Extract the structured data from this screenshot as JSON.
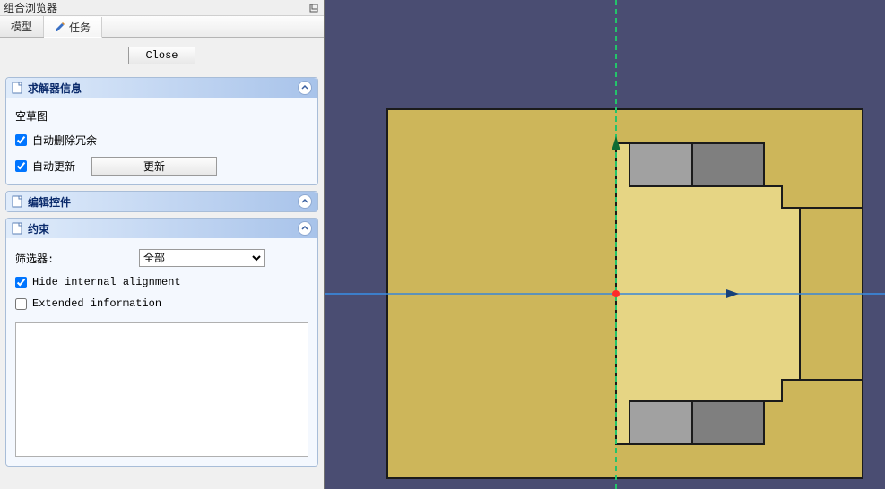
{
  "panel": {
    "title": "组合浏览器",
    "tabs": {
      "model": "模型",
      "tasks": "任务"
    },
    "close_label": "Close"
  },
  "solver_section": {
    "title": "求解器信息",
    "empty_sketch": "空草图",
    "auto_remove_redundant": "自动删除冗余",
    "auto_update": "自动更新",
    "update_btn": "更新"
  },
  "edit_section": {
    "title": "编辑控件"
  },
  "constraints_section": {
    "title": "约束",
    "filter_label": "筛选器:",
    "filter_value": "全部",
    "hide_internal": "Hide internal alignment",
    "extended_info": "Extended information"
  },
  "viewport": {
    "bg": "#4a4d72",
    "body_fill": "#cdb65a",
    "body_fill_light": "#e6d584",
    "step_fill": "#a1a1a1",
    "step_fill_dark": "#7f7f7f",
    "edge": "#1b1b1b",
    "x_axis": "#3a86d6",
    "y_axis": "#23c46a",
    "origin": "#ff2a2a",
    "arrow_x": "#16417a",
    "arrow_y": "#0f6b33"
  }
}
